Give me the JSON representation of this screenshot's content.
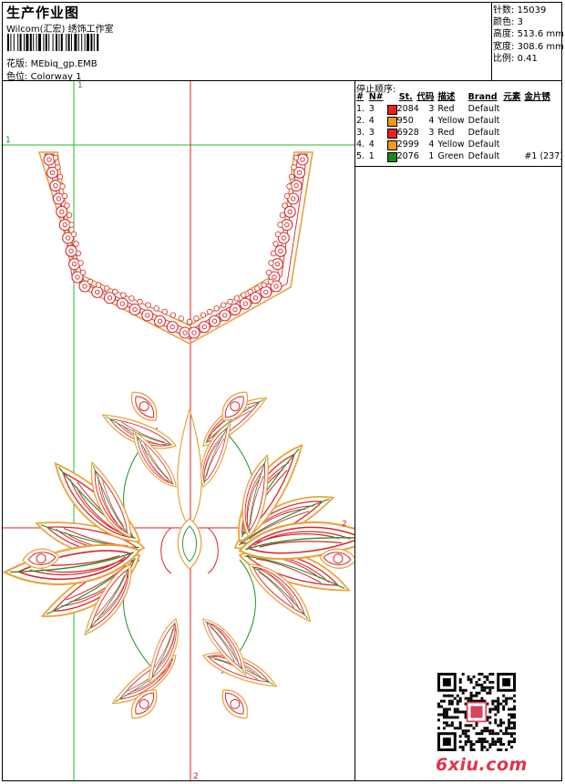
{
  "header": {
    "title": "生产作业图",
    "subtitle": "Wilcom(汇宏) 绣饰工作室",
    "design_label": "花版:",
    "design_value": "MEbiq_gp.EMB",
    "colorway_label": "色位:",
    "colorway_value": "Colorway 1"
  },
  "stats": [
    {
      "label": "针数:",
      "value": "15039"
    },
    {
      "label": "颜色:",
      "value": "3"
    },
    {
      "label": "高度:",
      "value": "513.6 mm"
    },
    {
      "label": "宽度:",
      "value": "308.6 mm"
    },
    {
      "label": "比例:",
      "value": "0.41"
    }
  ],
  "stop_sequence": {
    "title": "停止顺序:",
    "columns": [
      "#",
      "N#",
      "St.",
      "代码",
      "描述",
      "Brand",
      "元素",
      "金片锈"
    ],
    "rows": [
      {
        "num": "1.",
        "n": "3",
        "color": "#e8221e",
        "st": "2084",
        "code": "3",
        "desc": "Red",
        "brand": "Default",
        "elem": "",
        "seq": ""
      },
      {
        "num": "2.",
        "n": "4",
        "color": "#f39a1c",
        "st": "950",
        "code": "4",
        "desc": "Yellow",
        "brand": "Default",
        "elem": "",
        "seq": ""
      },
      {
        "num": "3.",
        "n": "3",
        "color": "#e8221e",
        "st": "6928",
        "code": "3",
        "desc": "Red",
        "brand": "Default",
        "elem": "",
        "seq": ""
      },
      {
        "num": "4.",
        "n": "4",
        "color": "#f39a1c",
        "st": "2999",
        "code": "4",
        "desc": "Yellow",
        "brand": "Default",
        "elem": "",
        "seq": ""
      },
      {
        "num": "5.",
        "n": "1",
        "color": "#1a8a1f",
        "st": "2076",
        "code": "1",
        "desc": "Green",
        "brand": "Default",
        "elem": "",
        "seq": "#1 (237)"
      }
    ]
  },
  "axis_labels": {
    "x1": "1",
    "y1": "1",
    "x2": "2",
    "y2": "2"
  },
  "watermark": "6xiu.com"
}
